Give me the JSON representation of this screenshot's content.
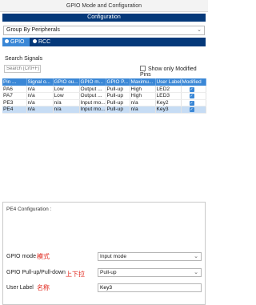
{
  "window": {
    "title": "GPIO Mode and Configuration"
  },
  "configuration_banner": "Configuration",
  "group_select": {
    "value": "Group By Peripherals"
  },
  "tabs": [
    {
      "label": "GPIO",
      "active": true
    },
    {
      "label": "RCC",
      "active": false
    }
  ],
  "search": {
    "title": "Search Signals",
    "placeholder": "Search (Crtl+F)",
    "show_modified_label": "Show only Modified Pins"
  },
  "table": {
    "headers": [
      "Pin ...",
      "Signal o...",
      "GPIO ou...",
      "GPIO m...",
      "GPIO P...",
      "Maximu...",
      "User Label",
      "Modified"
    ],
    "rows": [
      [
        "PA6",
        "n/a",
        "Low",
        "Output ...",
        "Pull-up",
        "High",
        "LED2"
      ],
      [
        "PA7",
        "n/a",
        "Low",
        "Output ...",
        "Pull-up",
        "High",
        "LED3"
      ],
      [
        "PE3",
        "n/a",
        "n/a",
        "Input mo...",
        "Pull-up",
        "n/a",
        "Key2"
      ],
      [
        "PE4",
        "n/a",
        "n/a",
        "Input mo...",
        "Pull-up",
        "n/a",
        "Key3"
      ]
    ],
    "modified": [
      true,
      true,
      true,
      true
    ],
    "selected_row": 3
  },
  "pin_config": {
    "title": "PE4 Configuration :",
    "gpio_mode": {
      "label": "GPIO mode",
      "annotation": "模式",
      "value": "Input mode"
    },
    "pull": {
      "label": "GPIO Pull-up/Pull-down",
      "annotation": "上下拉",
      "value": "Pull-up"
    },
    "user_label": {
      "label": "User Label",
      "annotation": "名称",
      "value": "Key3"
    }
  },
  "colors": {
    "header_blue": "#3a87d6",
    "banner_navy": "#05397a",
    "selected_row": "#c6dcf4",
    "annotation_red": "#e0261b"
  }
}
